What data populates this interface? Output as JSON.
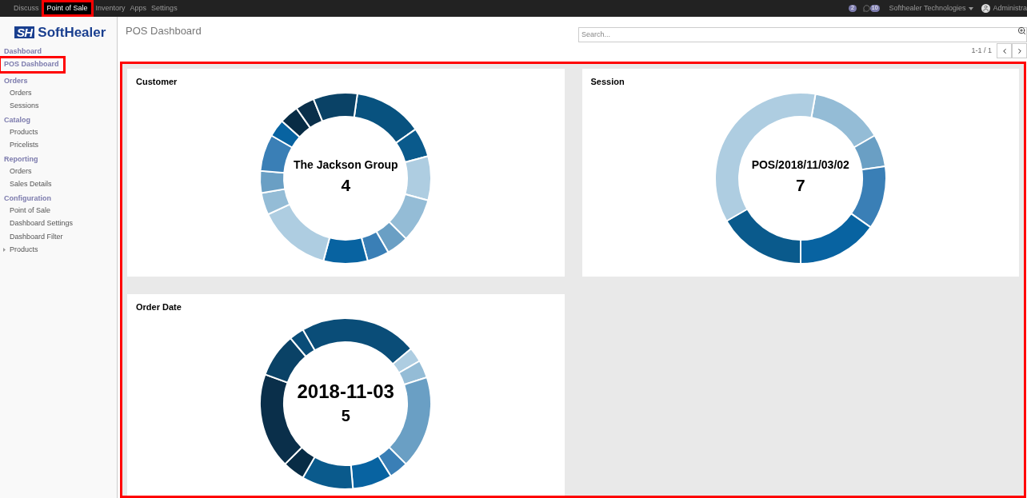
{
  "top_menu": [
    {
      "label": "Discuss",
      "selected": false
    },
    {
      "label": "Point of Sale",
      "selected": true
    },
    {
      "label": "Inventory",
      "selected": false
    },
    {
      "label": "Apps",
      "selected": false
    },
    {
      "label": "Settings",
      "selected": false
    }
  ],
  "systray": {
    "activity_count": "2",
    "message_count": "10",
    "company": "Softhealer Technologies",
    "user": "Administra"
  },
  "logo": {
    "mark": "SH",
    "text": "SoftHealer"
  },
  "sidebar": {
    "items": [
      {
        "kind": "section",
        "label": "Dashboard",
        "selected": false
      },
      {
        "kind": "section",
        "label": "POS Dashboard",
        "selected": true
      },
      {
        "kind": "section",
        "label": "Orders",
        "selected": false
      },
      {
        "kind": "item",
        "label": "Orders",
        "selected": false
      },
      {
        "kind": "item",
        "label": "Sessions",
        "selected": false
      },
      {
        "kind": "section",
        "label": "Catalog",
        "selected": false
      },
      {
        "kind": "item",
        "label": "Products",
        "selected": false
      },
      {
        "kind": "item",
        "label": "Pricelists",
        "selected": false
      },
      {
        "kind": "section",
        "label": "Reporting",
        "selected": false
      },
      {
        "kind": "item",
        "label": "Orders",
        "selected": false
      },
      {
        "kind": "item",
        "label": "Sales Details",
        "selected": false
      },
      {
        "kind": "section",
        "label": "Configuration",
        "selected": false
      },
      {
        "kind": "item",
        "label": "Point of Sale",
        "selected": false
      },
      {
        "kind": "item",
        "label": "Dashboard Settings",
        "selected": false
      },
      {
        "kind": "item",
        "label": "Dashboard Filter",
        "selected": false
      },
      {
        "kind": "folder",
        "label": "Products",
        "selected": false
      }
    ]
  },
  "header": {
    "title": "POS Dashboard",
    "search": {
      "placeholder": "Search..."
    },
    "pager": "1-1 / 1"
  },
  "widgets": [
    {
      "title": "Customer",
      "center_label": "The Jackson Group",
      "center_value": "4",
      "kind": "customer"
    },
    {
      "title": "Session",
      "center_label": "POS/2018/11/03/02",
      "center_value": "7",
      "kind": "session"
    },
    {
      "title": "Order Date",
      "center_label": "2018-11-03",
      "center_value": "5",
      "kind": "date"
    }
  ]
}
